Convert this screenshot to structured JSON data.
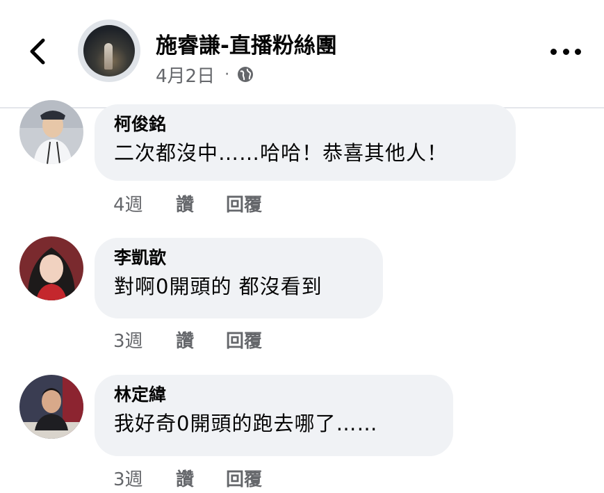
{
  "header": {
    "page_name": "施睿謙-直播粉絲團",
    "date": "4月2日",
    "separator": "·",
    "back_icon": "chevron-left-icon",
    "privacy_icon": "globe-icon",
    "more_icon": "more-horizontal-icon"
  },
  "comments": [
    {
      "author": "柯俊銘",
      "text": "二次都沒中……哈哈！恭喜其他人！",
      "time": "4週",
      "like_label": "讚",
      "reply_label": "回覆"
    },
    {
      "author": "李凱歆",
      "text": "對啊0開頭的 都沒看到",
      "time": "3週",
      "like_label": "讚",
      "reply_label": "回覆"
    },
    {
      "author": "林定緯",
      "text": "我好奇0開頭的跑去哪了……",
      "time": "3週",
      "like_label": "讚",
      "reply_label": "回覆"
    }
  ],
  "colors": {
    "bubble_bg": "#f0f2f5",
    "secondary_text": "#65676b",
    "primary_text": "#050505"
  }
}
